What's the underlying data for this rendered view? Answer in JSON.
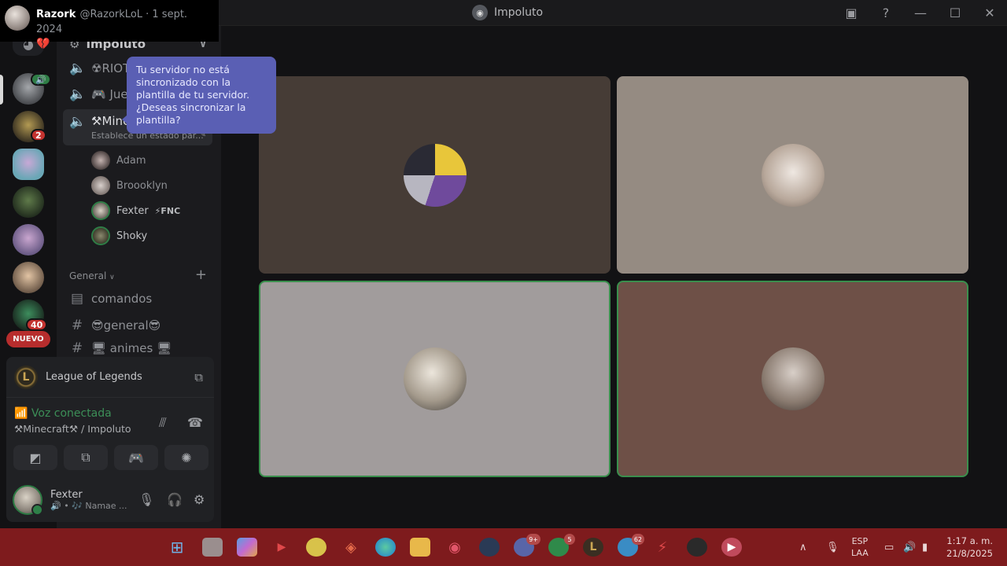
{
  "tweet": {
    "name": "Razork",
    "handle_date": "@RazorkLoL · 1 sept. 2024",
    "emoji": "💔"
  },
  "window": {
    "title": "Impoluto"
  },
  "titlebar_icons": [
    "inbox-icon",
    "help-icon",
    "minimize-icon",
    "maximize-icon",
    "close-icon"
  ],
  "server_rail": {
    "badges": {
      "gaming": "2",
      "zedd": "40"
    },
    "nuevo_label": "NUEVO"
  },
  "sidebar": {
    "server_name": "Impoluto",
    "channels_top": [
      {
        "name": "☢RIOT",
        "type": "voice"
      },
      {
        "name": "🎮 Jue",
        "type": "voice"
      }
    ],
    "active_channel": {
      "name": "⚒Mine",
      "status": "Establece un estado par..."
    },
    "members": [
      {
        "name": "Adam"
      },
      {
        "name": "Broooklyn"
      },
      {
        "name": "Fexter",
        "tag": "⚡FNC"
      },
      {
        "name": "Shoky"
      }
    ],
    "category": {
      "name": "General"
    },
    "text_channels": [
      {
        "name": "comandos"
      },
      {
        "name": "😎general😎"
      },
      {
        "name": "🖥 animes 🖥"
      }
    ]
  },
  "tooltip": {
    "text": "Tu servidor no está sincronizado con la plantilla de tu servidor. ¿Deseas sincronizar la plantilla?"
  },
  "panel": {
    "activity": {
      "game": "League of Legends",
      "logo_letter": "L"
    },
    "voice": {
      "status": "Voz conectada",
      "location": "⚒Minecraft⚒ / Impoluto"
    },
    "user": {
      "name": "Fexter",
      "status": "🔊 • 🎶 Namae ..."
    }
  },
  "taskbar": {
    "badges": {
      "discord": "9+",
      "whatsapp": "5",
      "telegram": "62"
    },
    "lang_1": "ESP",
    "lang_2": "LAA",
    "time": "1:17 a. m.",
    "date": "21/8/2025"
  },
  "colors": {
    "accent": "#5a5fb4",
    "speaking": "#3a8f4d",
    "taskbar": "#7e1b1d"
  }
}
